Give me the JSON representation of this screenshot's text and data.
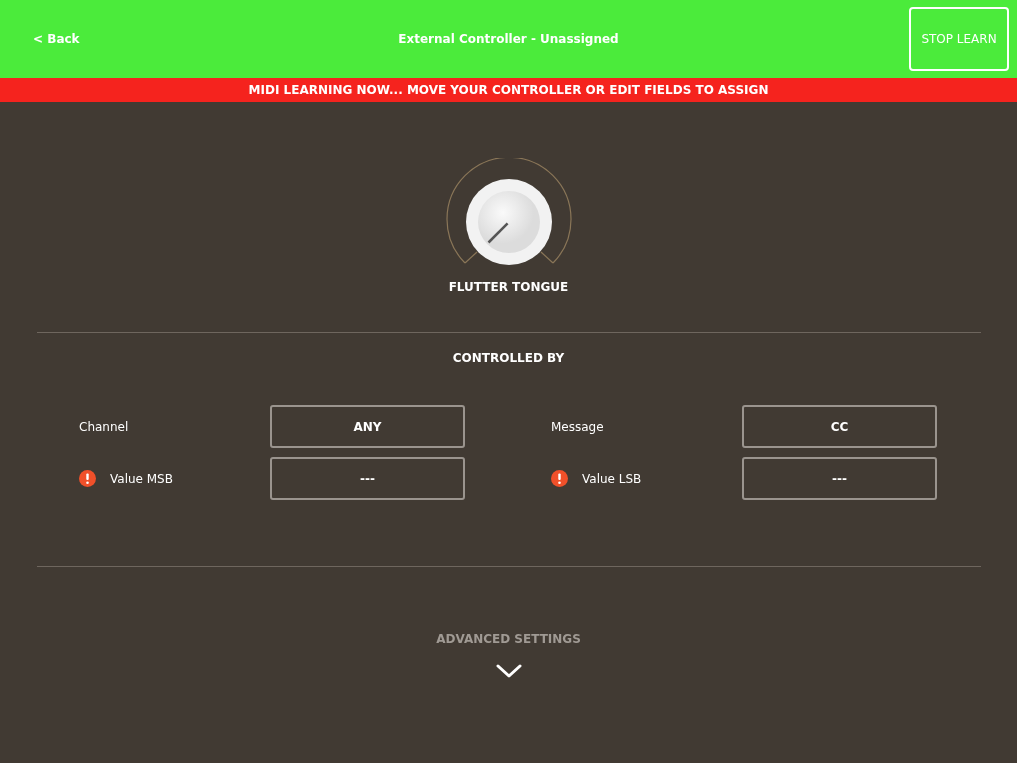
{
  "header": {
    "back": "< Back",
    "title": "External Controller - Unassigned",
    "action": "STOP LEARN"
  },
  "banner": "MIDI LEARNING NOW... MOVE YOUR CONTROLLER OR EDIT FIELDS TO ASSIGN",
  "knob": {
    "label": "FLUTTER TONGUE"
  },
  "section_title": "CONTROLLED BY",
  "fields": [
    {
      "label": "Channel",
      "value": "ANY",
      "warning": false
    },
    {
      "label": "Message",
      "value": "CC",
      "warning": false
    },
    {
      "label": "Value MSB",
      "value": "---",
      "warning": true
    },
    {
      "label": "Value LSB",
      "value": "---",
      "warning": true
    }
  ],
  "advanced": {
    "label": "ADVANCED SETTINGS",
    "expanded": false
  }
}
